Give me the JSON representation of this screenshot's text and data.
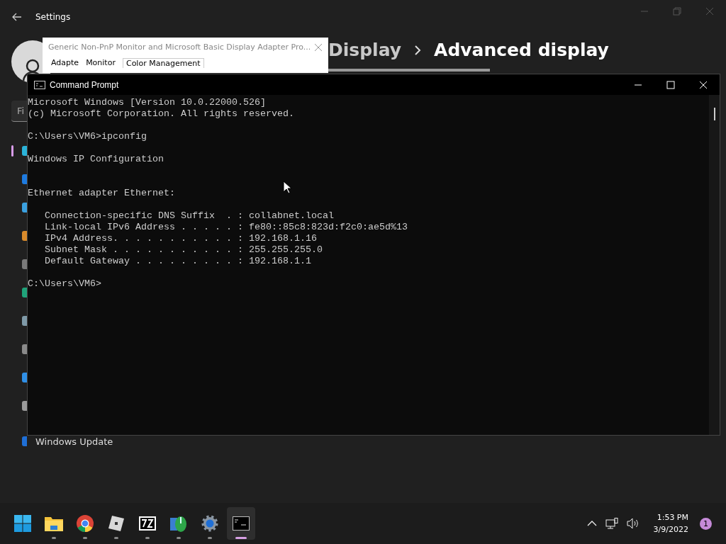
{
  "settings": {
    "title": "Settings",
    "breadcrumb": [
      {
        "label": "Display"
      },
      {
        "label": "Advanced display"
      }
    ],
    "search": {
      "placeholder": "Fi"
    },
    "nav": [
      {
        "selected": true
      },
      {
        "selected": false
      },
      {
        "selected": false
      },
      {
        "selected": false
      },
      {
        "selected": false
      },
      {
        "selected": false
      },
      {
        "selected": false
      },
      {
        "selected": false
      },
      {
        "selected": false
      },
      {
        "selected": false
      },
      {
        "selected": false,
        "label": "Windows Update"
      }
    ]
  },
  "dialog": {
    "title": "Generic Non-PnP Monitor and Microsoft Basic Display Adapter Pro...",
    "tabs": [
      {
        "label": "Adapte",
        "selected": false
      },
      {
        "label": "Monitor",
        "selected": false
      },
      {
        "label": "Color Management",
        "selected": true
      }
    ]
  },
  "console": {
    "title": "Command Prompt",
    "blocks": [
      "Microsoft Windows [Version 10.0.22000.526]\n(c) Microsoft Corporation. All rights reserved.",
      "C:\\Users\\VM6>ipconfig",
      "Windows IP Configuration",
      "\nEthernet adapter Ethernet:",
      "   Connection-specific DNS Suffix  . : collabnet.local\n   Link-local IPv6 Address . . . . . : fe80::85c8:823d:f2c0:ae5d%13\n   IPv4 Address. . . . . . . . . . . : 192.168.1.16\n   Subnet Mask . . . . . . . . . . . : 255.255.255.0\n   Default Gateway . . . . . . . . . : 192.168.1.1",
      "C:\\Users\\VM6>"
    ]
  },
  "taskbar": {
    "apps": [
      {
        "kind": "start",
        "running": false,
        "selected": false
      },
      {
        "kind": "folder",
        "running": true,
        "selected": false
      },
      {
        "kind": "browser",
        "running": true,
        "selected": false
      },
      {
        "kind": "cube",
        "running": true,
        "selected": false
      },
      {
        "kind": "archive",
        "running": true,
        "selected": false
      },
      {
        "kind": "mouse",
        "running": true,
        "selected": false
      },
      {
        "kind": "gear",
        "running": true,
        "selected": false
      },
      {
        "kind": "terminal",
        "running": true,
        "selected": true
      }
    ],
    "time": "1:53 PM",
    "date": "3/9/2022",
    "badge": "1"
  }
}
